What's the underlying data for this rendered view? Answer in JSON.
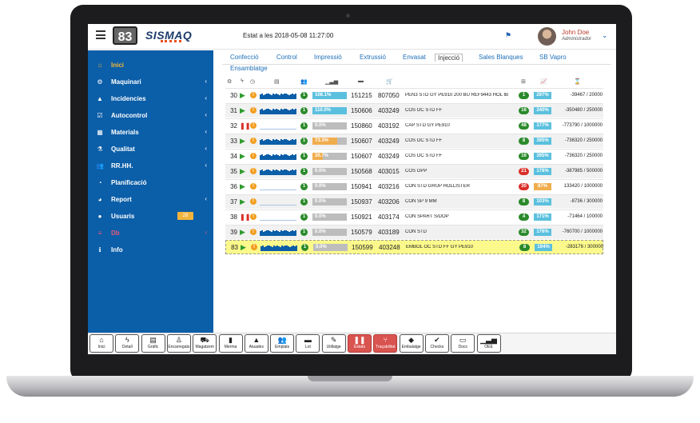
{
  "header": {
    "logo_number": "83",
    "logo_text": "SISMAQ",
    "status_text": "Estat a les 2018-05-08 11:27:00",
    "user_name": "John Doe",
    "user_role": "Administrador"
  },
  "sidebar": {
    "items": [
      {
        "label": "Inici",
        "icon": "home-icon",
        "active": true
      },
      {
        "label": "Maquinari",
        "icon": "cogs-icon"
      },
      {
        "label": "Incidencies",
        "icon": "warning-icon"
      },
      {
        "label": "Autocontrol",
        "icon": "checkbox-icon"
      },
      {
        "label": "Materials",
        "icon": "cubes-icon"
      },
      {
        "label": "Qualitat",
        "icon": "flask-icon"
      },
      {
        "label": "RR.HH.",
        "icon": "users-icon"
      },
      {
        "label": "Planificació",
        "icon": "clock-icon"
      },
      {
        "label": "Report",
        "icon": "pie-chart-icon"
      },
      {
        "label": "Usuaris",
        "icon": "user-icon",
        "badge": "28"
      },
      {
        "label": "Db",
        "icon": "database-icon"
      },
      {
        "label": "Info",
        "icon": "info-icon"
      }
    ]
  },
  "tabs": [
    "Confecció",
    "Control",
    "Impressió",
    "Extrussió",
    "Envasat",
    "Injecció",
    "Sales Blanques",
    "SB Vapro",
    "Ensamblatge"
  ],
  "active_tab": "Injecció",
  "rows": [
    {
      "num": "30",
      "state": "play",
      "prog": "108.1%",
      "prog_value": 100,
      "prog_color": "#5bc0de",
      "order": "151215",
      "article": "807050",
      "desc": "PEN3 STD GY PE910 200 BU REF9443 HOL IB",
      "count": "1",
      "count_color": "#2a8a2a",
      "pct": "297%",
      "pct_color": "#5bc0de",
      "qty": "-39467 / 20000"
    },
    {
      "num": "31",
      "state": "play",
      "prog": "110.0%",
      "prog_value": 100,
      "prog_color": "#5bc0de",
      "order": "150606",
      "article": "403249",
      "desc": "COS OC STD FF",
      "count": "16",
      "count_color": "#2a8a2a",
      "pct": "240%",
      "pct_color": "#5bc0de",
      "qty": "-350480 / 250000"
    },
    {
      "num": "32",
      "state": "stop",
      "prog": "0.0%",
      "prog_value": 0,
      "prog_color": "#bdbdbd",
      "order": "150860",
      "article": "403192",
      "desc": "CAP STD GY PE910",
      "count": "48",
      "count_color": "#2a8a2a",
      "pct": "177%",
      "pct_color": "#5bc0de",
      "qty": "-773790 / 1000000"
    },
    {
      "num": "33",
      "state": "play",
      "prog": "73.3%",
      "prog_value": 73,
      "prog_color": "#f0ad4e",
      "order": "150607",
      "article": "403249",
      "desc": "COS OC STD FF",
      "count": "8",
      "count_color": "#2a8a2a",
      "pct": "395%",
      "pct_color": "#5bc0de",
      "qty": "-736320 / 250000"
    },
    {
      "num": "34",
      "state": "play",
      "prog": "30.7%",
      "prog_value": 31,
      "prog_color": "#f0ad4e",
      "order": "150607",
      "article": "403249",
      "desc": "COS OC STD FF",
      "count": "16",
      "count_color": "#2a8a2a",
      "pct": "395%",
      "pct_color": "#5bc0de",
      "qty": "-736320 / 250000"
    },
    {
      "num": "35",
      "state": "play",
      "prog": "0.0%",
      "prog_value": 0,
      "prog_color": "#bdbdbd",
      "order": "150568",
      "article": "403015",
      "desc": "COS OPP",
      "count": "21",
      "count_color": "#d9302a",
      "pct": "178%",
      "pct_color": "#5bc0de",
      "qty": "-387985 / 500000"
    },
    {
      "num": "36",
      "state": "play",
      "prog": "0.0%",
      "prog_value": 0,
      "prog_color": "#bdbdbd",
      "order": "150941",
      "article": "403216",
      "desc": "CON STD GRUP HOLLISTER",
      "count": "30",
      "count_color": "#d9302a",
      "pct": "87%",
      "pct_color": "#f0ad4e",
      "qty": "133420 / 1000000"
    },
    {
      "num": "37",
      "state": "play",
      "prog": "0.0%",
      "prog_value": 0,
      "prog_color": "#bdbdbd",
      "order": "150937",
      "article": "403206",
      "desc": "CON SP 9 MM",
      "count": "8",
      "count_color": "#2a8a2a",
      "pct": "103%",
      "pct_color": "#5bc0de",
      "qty": "-8736 / 300000"
    },
    {
      "num": "38",
      "state": "stop",
      "prog": "0.0%",
      "prog_value": 0,
      "prog_color": "#bdbdbd",
      "order": "150921",
      "article": "403174",
      "desc": "CON SPART S/DOP",
      "count": "4",
      "count_color": "#2a8a2a",
      "pct": "171%",
      "pct_color": "#5bc0de",
      "qty": "-71464 / 100000"
    },
    {
      "num": "39",
      "state": "play",
      "prog": "0.0%",
      "prog_value": 0,
      "prog_color": "#bdbdbd",
      "order": "150579",
      "article": "403189",
      "desc": "CON STD",
      "count": "32",
      "count_color": "#2a8a2a",
      "pct": "176%",
      "pct_color": "#5bc0de",
      "qty": "-760700 / 1000000"
    },
    {
      "num": "83",
      "state": "play",
      "prog": "0.0%",
      "prog_value": 0,
      "prog_color": "#bdbdbd",
      "order": "150599",
      "article": "403248",
      "desc": "EMBOL OC STD FF GY PE910",
      "count": "8",
      "count_color": "#2a8a2a",
      "pct": "194%",
      "pct_color": "#5bc0de",
      "qty": "-283176 / 300000",
      "highlight": true
    }
  ],
  "toolbar": [
    {
      "label": "Inici",
      "icon": "home-icon"
    },
    {
      "label": "Detall",
      "icon": "bolt-icon"
    },
    {
      "label": "Gràfic",
      "icon": "chart-icon"
    },
    {
      "label": "Encarregats",
      "icon": "worker-icon"
    },
    {
      "label": "Magatzem",
      "icon": "forklift-icon"
    },
    {
      "label": "Merma",
      "icon": "trash-icon"
    },
    {
      "label": "Atuades",
      "icon": "warning-icon"
    },
    {
      "label": "Emplats",
      "icon": "users-icon"
    },
    {
      "label": "Lot",
      "icon": "folder-icon"
    },
    {
      "label": "Utillatge",
      "icon": "wrench-icon"
    },
    {
      "label": "Estats",
      "icon": "pause-icon",
      "red": true
    },
    {
      "label": "Traçabilitat",
      "icon": "branch-icon",
      "red": true
    },
    {
      "label": "Embalatge",
      "icon": "box-icon"
    },
    {
      "label": "Checks",
      "icon": "check-icon"
    },
    {
      "label": "Docs",
      "icon": "docs-icon"
    },
    {
      "label": "OEE",
      "icon": "signal-icon"
    }
  ]
}
